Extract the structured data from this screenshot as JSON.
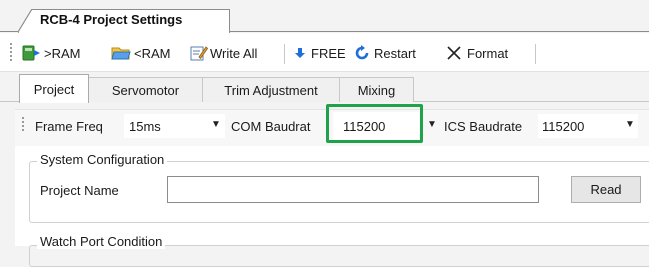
{
  "document_tab": {
    "title": "RCB-4 Project Settings"
  },
  "toolbar": {
    "to_ram": ">RAM",
    "from_ram": "<RAM",
    "write_all": "Write All",
    "free": "FREE",
    "restart": "Restart",
    "format": "Format"
  },
  "tabs": [
    {
      "label": "Project",
      "active": true
    },
    {
      "label": "Servomotor",
      "active": false
    },
    {
      "label": "Trim Adjustment",
      "active": false
    },
    {
      "label": "Mixing",
      "active": false
    }
  ],
  "options": {
    "frame_freq": {
      "label": "Frame Freq",
      "value": "15ms"
    },
    "com_baudrate": {
      "label": "COM Baudrat",
      "value": "115200"
    },
    "ics_baudrate": {
      "label": "ICS Baudrate",
      "value": "115200"
    }
  },
  "system_configuration": {
    "title": "System Configuration",
    "project_name_label": "Project Name",
    "project_name_value": "",
    "read_button": "Read"
  },
  "watch_port": {
    "title": "Watch Port Condition"
  },
  "colors": {
    "highlight": "#20a24a",
    "accent_blue": "#1e6fd9"
  }
}
